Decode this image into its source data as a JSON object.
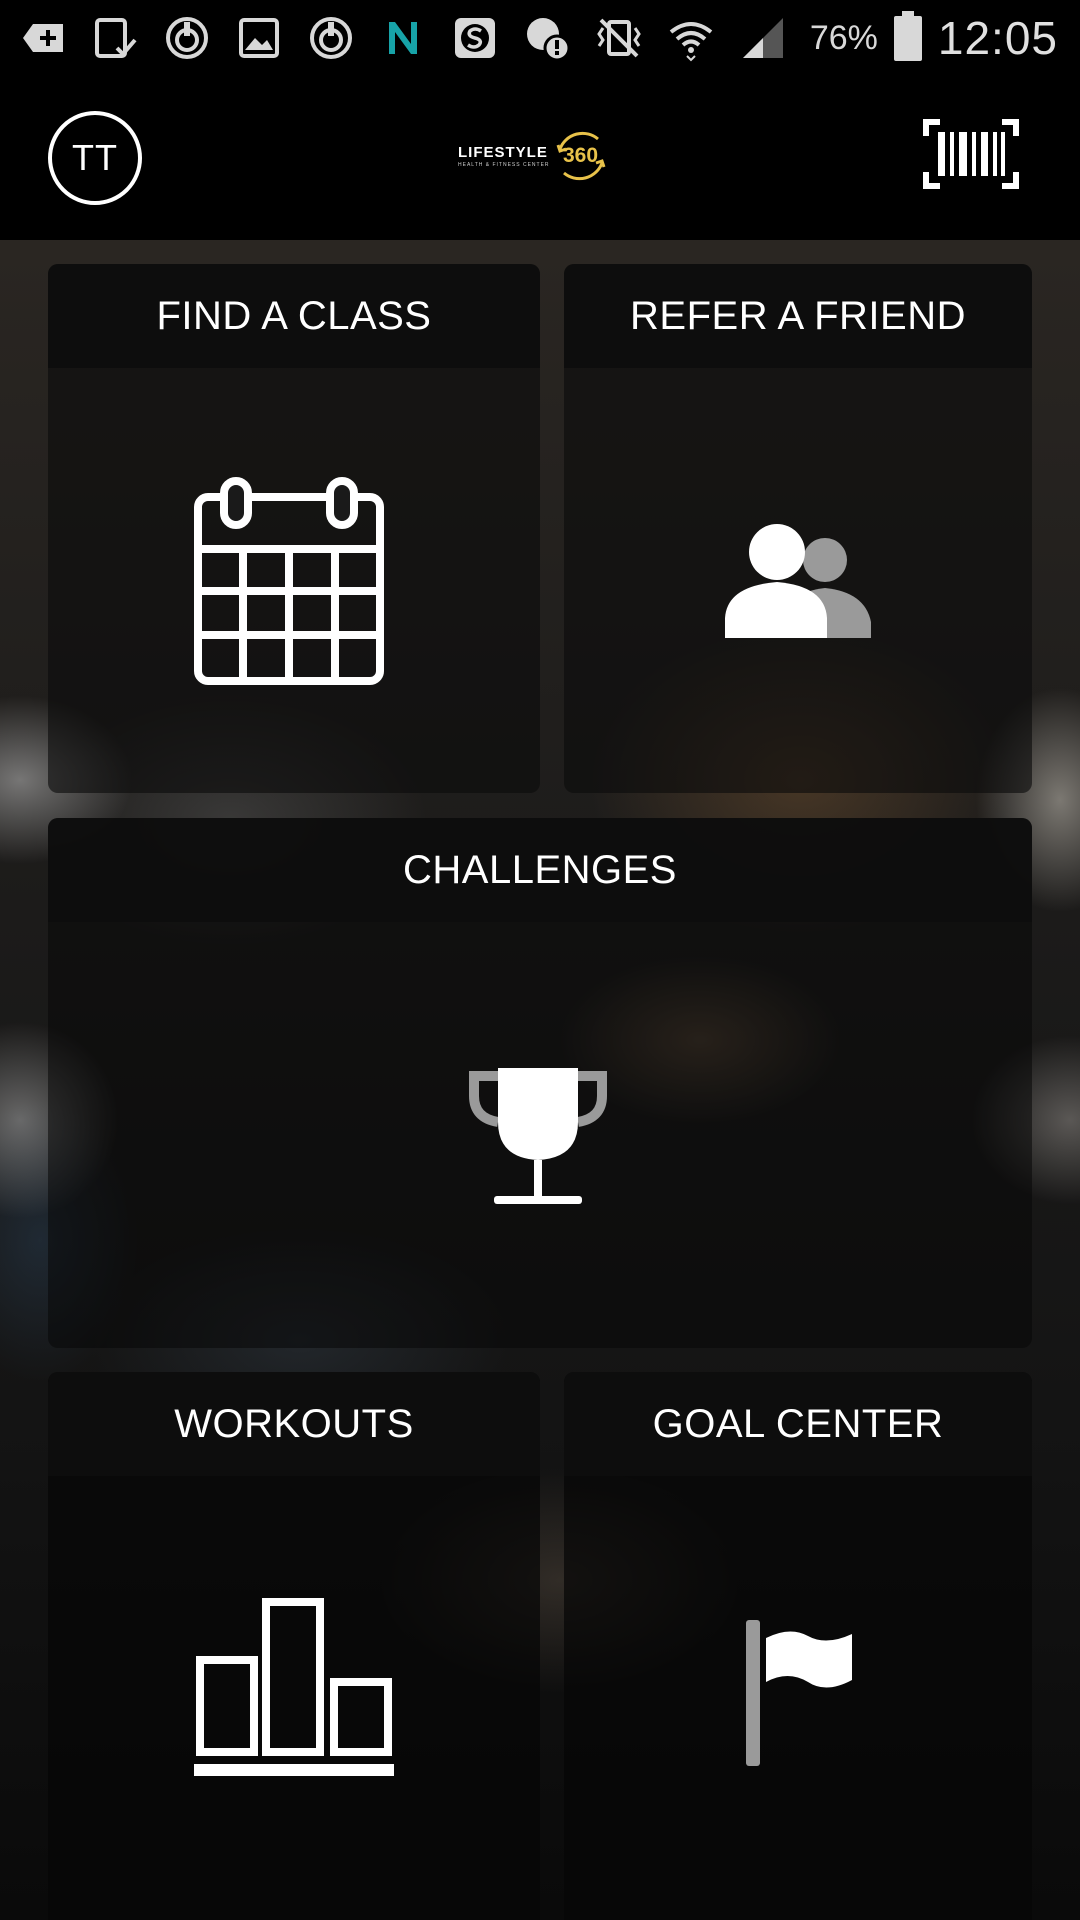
{
  "status_bar": {
    "icons": [
      "add-box-icon",
      "tablet-check-icon",
      "sync-circle-icon",
      "image-icon",
      "sync-circle-icon",
      "n-letter-icon",
      "s-square-icon",
      "alert-circle-icon",
      "vibrate-icon",
      "wifi-icon",
      "signal-icon",
      "battery-icon"
    ],
    "battery": "76%",
    "time": "12:05"
  },
  "header": {
    "avatar_initials": "TT",
    "logo": {
      "name": "LIFESTYLE",
      "tagline": "HEALTH & FITNESS CENTER",
      "badge": "360",
      "badge_color": "#e8c24a"
    },
    "barcode_icon": "barcode-scan-icon"
  },
  "tiles": [
    {
      "label": "FIND A CLASS",
      "icon": "calendar-icon"
    },
    {
      "label": "REFER A FRIEND",
      "icon": "people-icon"
    },
    {
      "label": "CHALLENGES",
      "icon": "trophy-icon"
    },
    {
      "label": "WORKOUTS",
      "icon": "bar-chart-icon"
    },
    {
      "label": "GOAL CENTER",
      "icon": "flag-icon"
    }
  ],
  "colors": {
    "accent": "#e8c24a",
    "header_bg": "#000000",
    "text": "#ffffff"
  }
}
